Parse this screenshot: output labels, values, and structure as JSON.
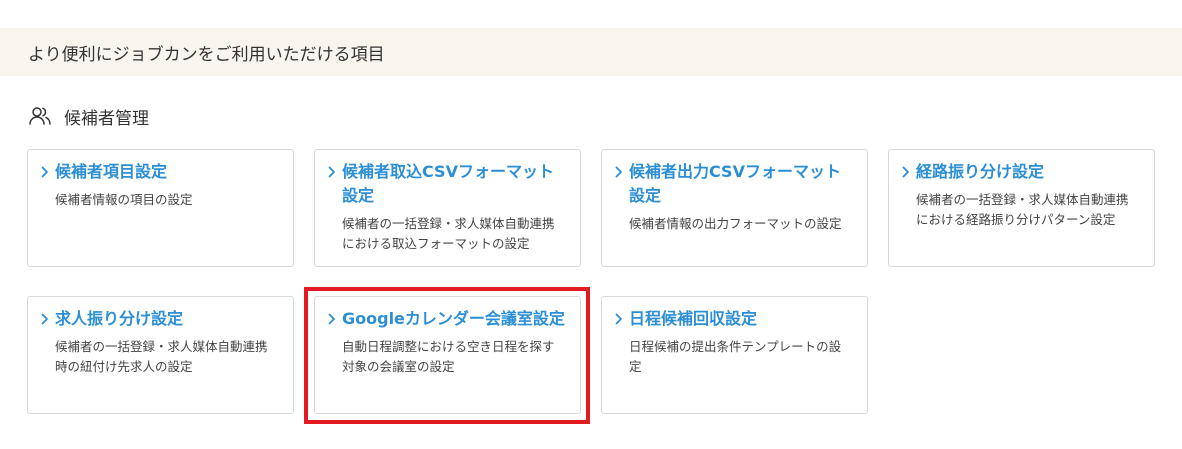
{
  "banner": {
    "text": "より便利にジョブカンをご利用いただける項目"
  },
  "section": {
    "title": "候補者管理",
    "icon": "users-icon"
  },
  "cards": [
    {
      "title": "候補者項目設定",
      "description": "候補者情報の項目の設定"
    },
    {
      "title": "候補者取込CSVフォーマット設定",
      "description": "候補者の一括登録・求人媒体自動連携における取込フォーマットの設定"
    },
    {
      "title": "候補者出力CSVフォーマット設定",
      "description": "候補者情報の出力フォーマットの設定"
    },
    {
      "title": "経路振り分け設定",
      "description": "候補者の一括登録・求人媒体自動連携における経路振り分けパターン設定"
    },
    {
      "title": "求人振り分け設定",
      "description": "候補者の一括登録・求人媒体自動連携時の紐付け先求人の設定"
    },
    {
      "title": "Googleカレンダー会議室設定",
      "description": "自動日程調整における空き日程を探す対象の会議室の設定"
    },
    {
      "title": "日程候補回収設定",
      "description": "日程候補の提出条件テンプレートの設定"
    }
  ],
  "colors": {
    "accent": "#2c8fd6",
    "banner_bg": "#f8f4ee",
    "highlight": "#e21b22",
    "card_border": "#d9d9d9"
  }
}
